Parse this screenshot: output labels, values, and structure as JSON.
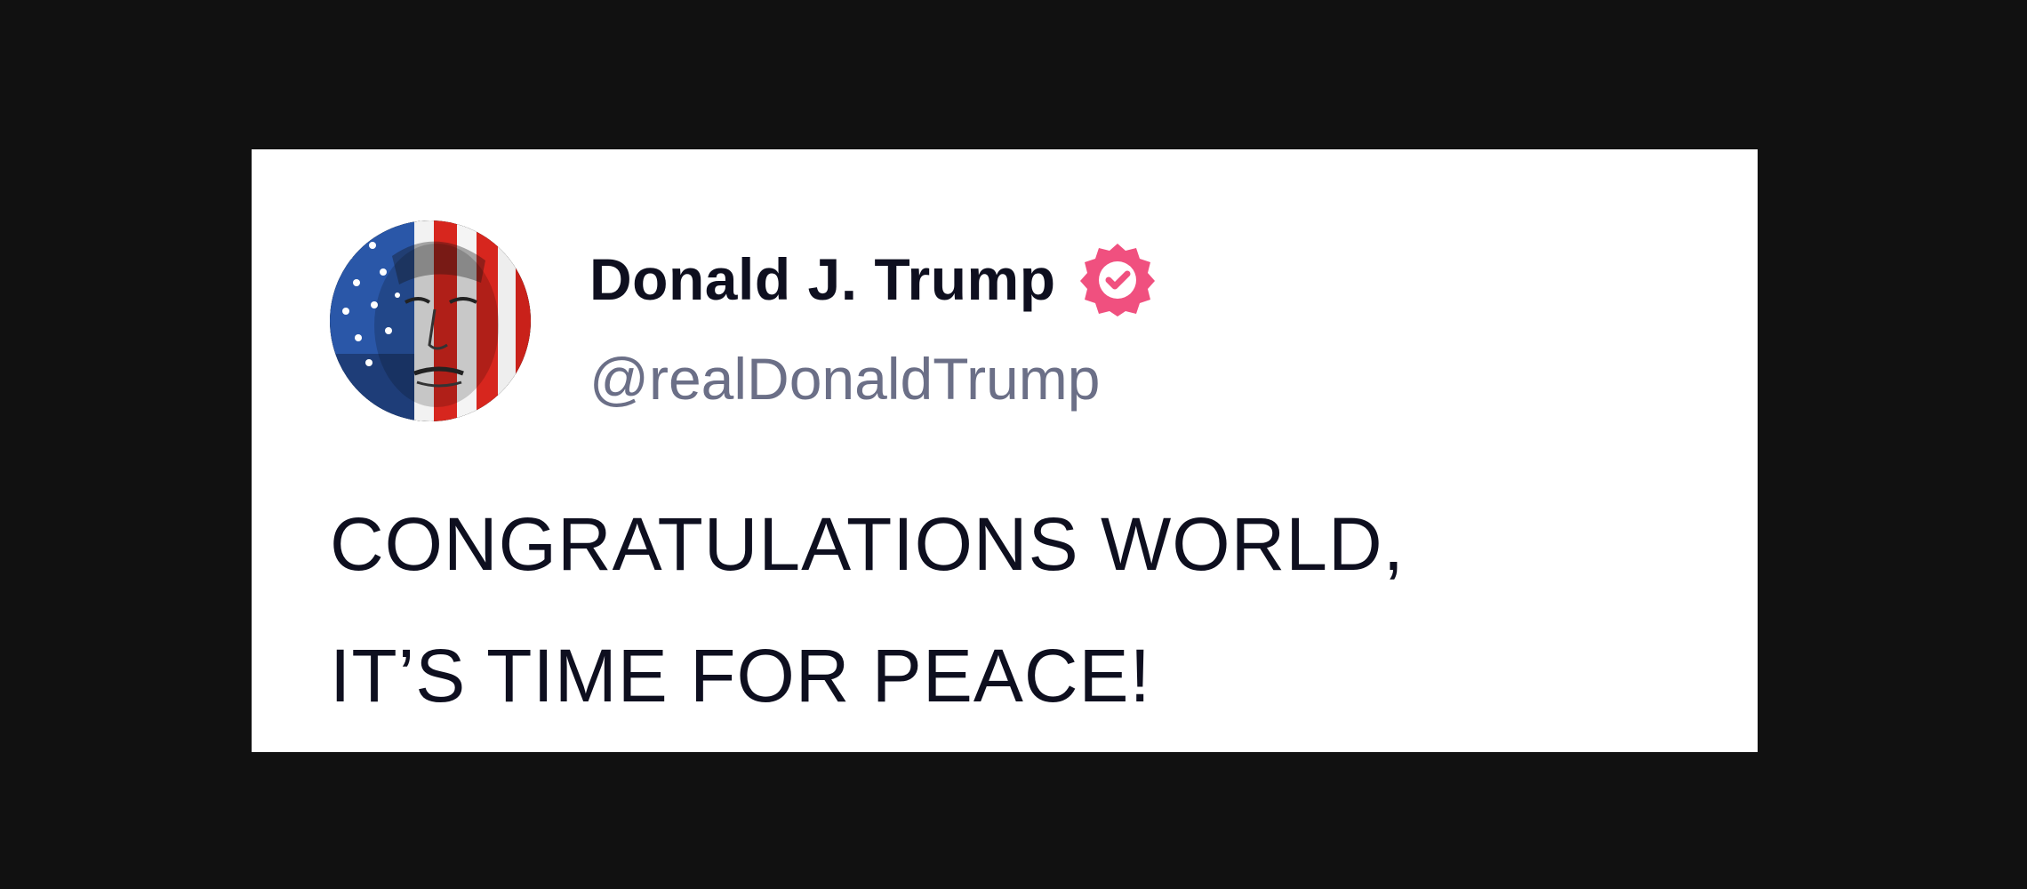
{
  "post": {
    "author": {
      "display_name": "Donald J. Trump",
      "handle": "@realDonaldTrump",
      "avatar_icon": "flag-portrait-avatar",
      "verified_icon": "verified-badge-icon",
      "verified_color": "#f0507f"
    },
    "text_lines": [
      "CONGRATULATIONS WORLD,",
      "IT’S TIME FOR PEACE!"
    ]
  }
}
